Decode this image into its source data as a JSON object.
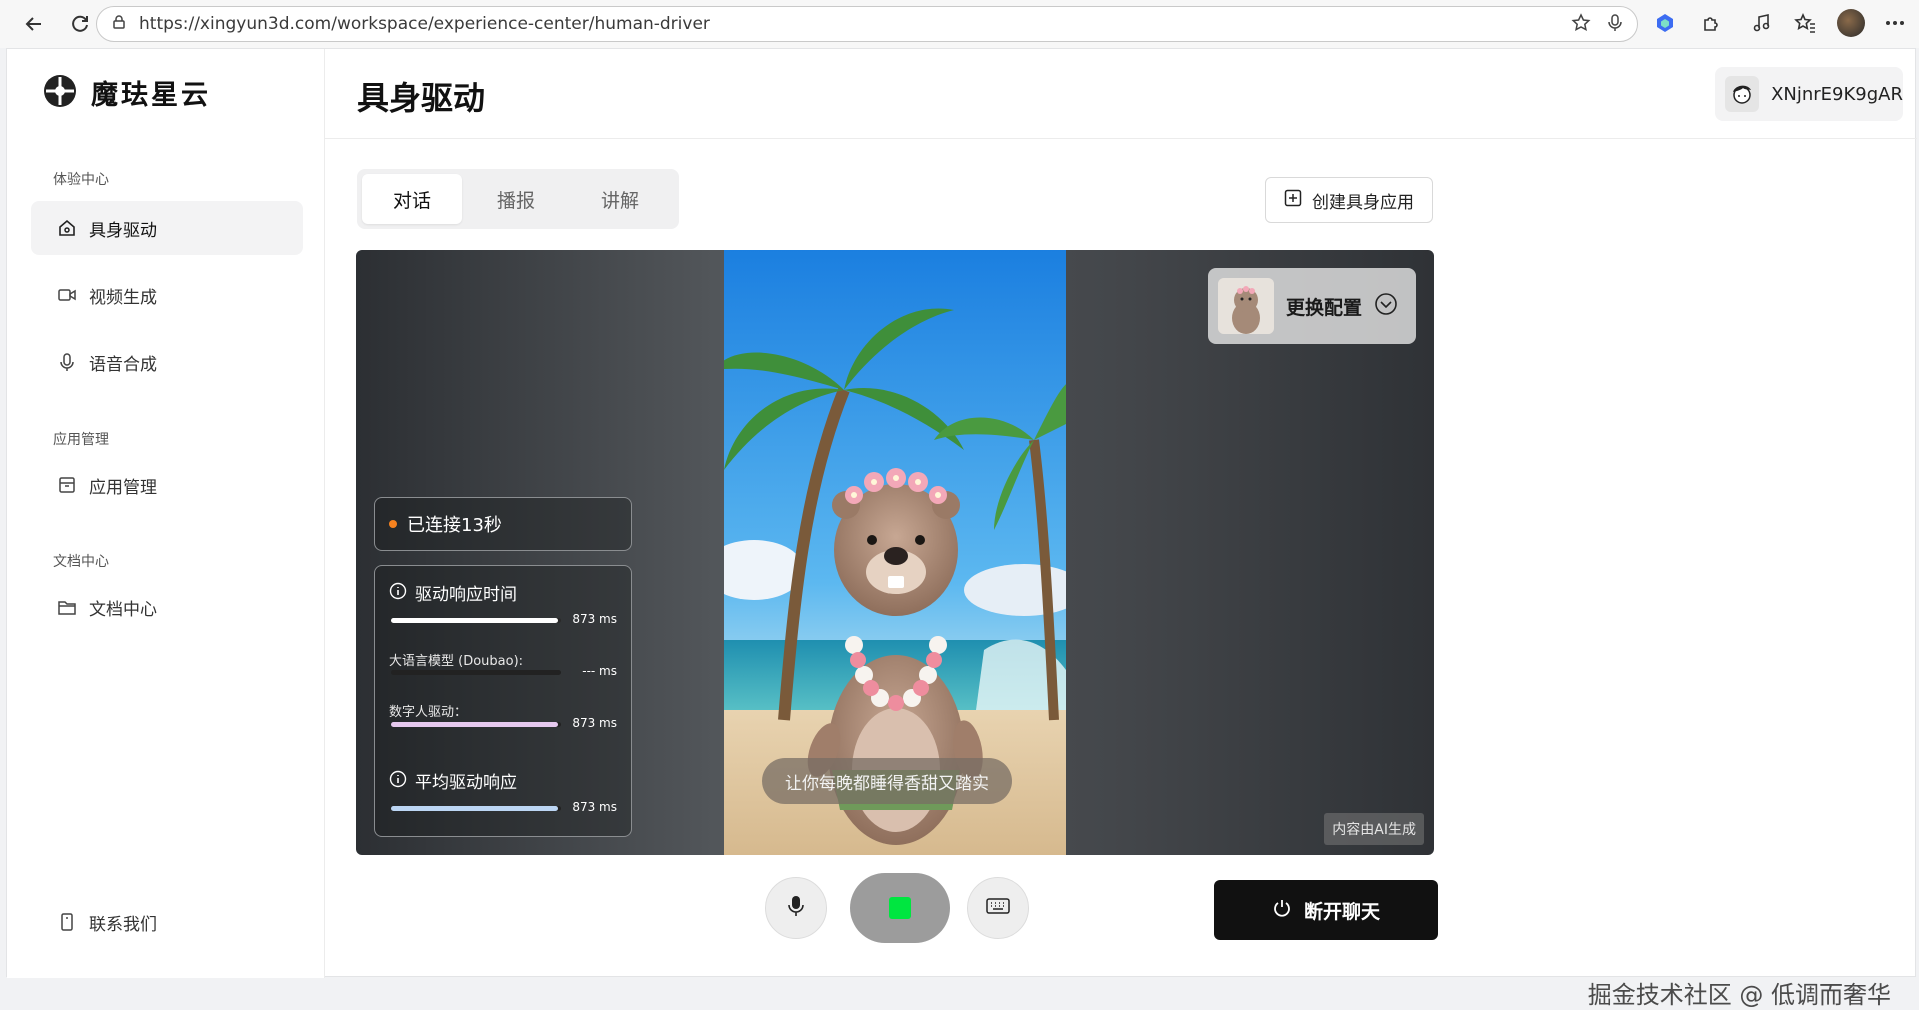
{
  "browser": {
    "url": "https://xingyun3d.com/workspace/experience-center/human-driver"
  },
  "brand": {
    "name": "魔珐星云"
  },
  "sidebar": {
    "groups": [
      {
        "title": "体验中心"
      },
      {
        "title": "应用管理"
      },
      {
        "title": "文档中心"
      }
    ],
    "items": [
      {
        "label": "具身驱动",
        "icon": "home-icon",
        "active": true
      },
      {
        "label": "视频生成",
        "icon": "video-camera-icon"
      },
      {
        "label": "语音合成",
        "icon": "microphone-icon"
      },
      {
        "label": "应用管理",
        "icon": "archive-icon"
      },
      {
        "label": "文档中心",
        "icon": "folder-icon"
      }
    ],
    "contact": {
      "label": "联系我们",
      "icon": "phone-icon"
    }
  },
  "header": {
    "title": "具身驱动",
    "user": {
      "name": "XNjnrE9K9gAR"
    }
  },
  "tabs": [
    {
      "label": "对话",
      "active": true
    },
    {
      "label": "播报"
    },
    {
      "label": "讲解"
    }
  ],
  "create_button": {
    "label": "创建具身应用"
  },
  "stage": {
    "config_label": "更换配置",
    "status": "已连接13秒",
    "metrics": {
      "response_title": "驱动响应时间",
      "response_value": "873 ms",
      "response_fill": 0.98,
      "llm_label": "大语言模型 (Doubao):",
      "llm_value": "--- ms",
      "llm_fill": 0,
      "driver_label": "数字人驱动：",
      "driver_value": "873 ms",
      "driver_fill": 0.98,
      "avg_title": "平均驱动响应",
      "avg_value": "873 ms",
      "avg_fill": 0.98
    },
    "subtitle": "让你每晚都睡得香甜又踏实",
    "ai_tag": "内容由AI生成"
  },
  "controls": {
    "end_label": "断开聊天",
    "accent": "#00e640"
  },
  "watermark": "掘金技术社区 @ 低调而奢华"
}
